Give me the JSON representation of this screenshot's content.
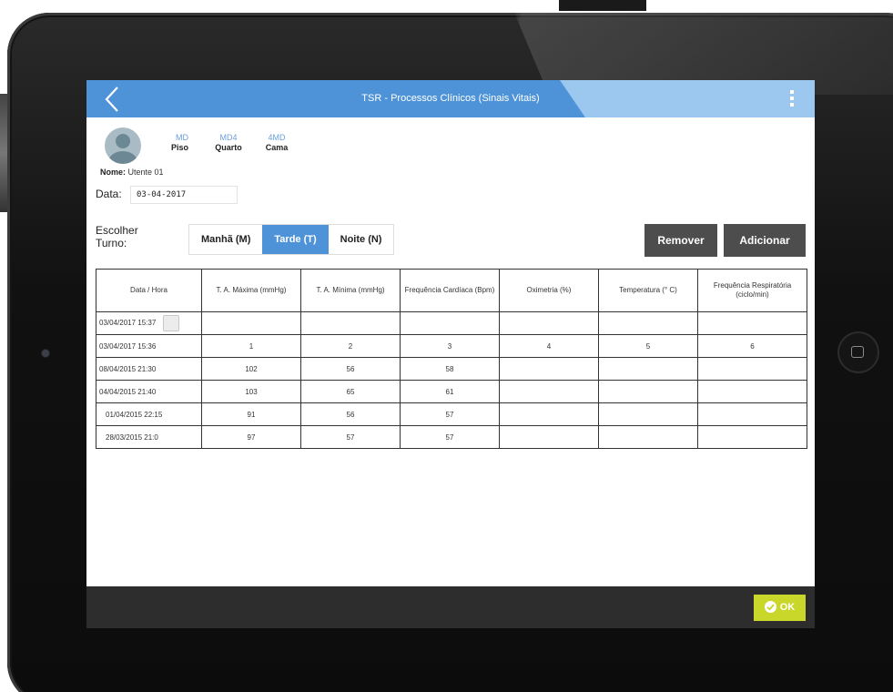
{
  "app": {
    "title": "TSR - Processos Clínicos (Sinais Vitais)"
  },
  "patient": {
    "piso_code": "MD",
    "piso_label": "Piso",
    "quarto_code": "MD4",
    "quarto_label": "Quarto",
    "cama_code": "4MD",
    "cama_label": "Cama",
    "nome_label": "Nome:",
    "nome_value": "Utente 01"
  },
  "date": {
    "label": "Data:",
    "value": "03-04-2017"
  },
  "shift": {
    "label": "Escolher Turno:",
    "options": [
      "Manhã (M)",
      "Tarde (T)",
      "Noite (N)"
    ],
    "selected": "Tarde (T)"
  },
  "actions": {
    "remove_label": "Remover",
    "add_label": "Adicionar"
  },
  "table": {
    "headers": [
      "Data / Hora",
      "T. A. Máxima (mmHg)",
      "T. A. Mínima (mmHg)",
      "Frequência Cardíaca (Bpm)",
      "Oximetria (%)",
      "Temperatura (° C)",
      "Frequência Respiratória (ciclo/min)"
    ],
    "rows": [
      [
        "03/04/2017 15:37",
        "",
        "",
        "",
        "",
        "",
        ""
      ],
      [
        "03/04/2017 15:36",
        "1",
        "2",
        "3",
        "4",
        "5",
        "6"
      ],
      [
        "08/04/2015 21:30",
        "102",
        "56",
        "58",
        "",
        "",
        ""
      ],
      [
        "04/04/2015 21:40",
        "103",
        "65",
        "61",
        "",
        "",
        ""
      ],
      [
        "01/04/2015 22:15",
        "91",
        "56",
        "57",
        "",
        "",
        ""
      ],
      [
        "28/03/2015 21:0",
        "97",
        "57",
        "57",
        "",
        "",
        ""
      ]
    ]
  },
  "footer": {
    "ok_label": "OK"
  },
  "colors": {
    "topbar": "#4e93d8",
    "accent_light": "#9cc7ef",
    "action_button": "#4d4d4d",
    "ok_button": "#c8d72a",
    "bottombar": "#2d2d2d"
  },
  "icons": {
    "back": "chevron-left-icon",
    "menu": "kebab-menu-icon",
    "avatar": "user-avatar-icon",
    "ok": "check-circle-icon"
  }
}
